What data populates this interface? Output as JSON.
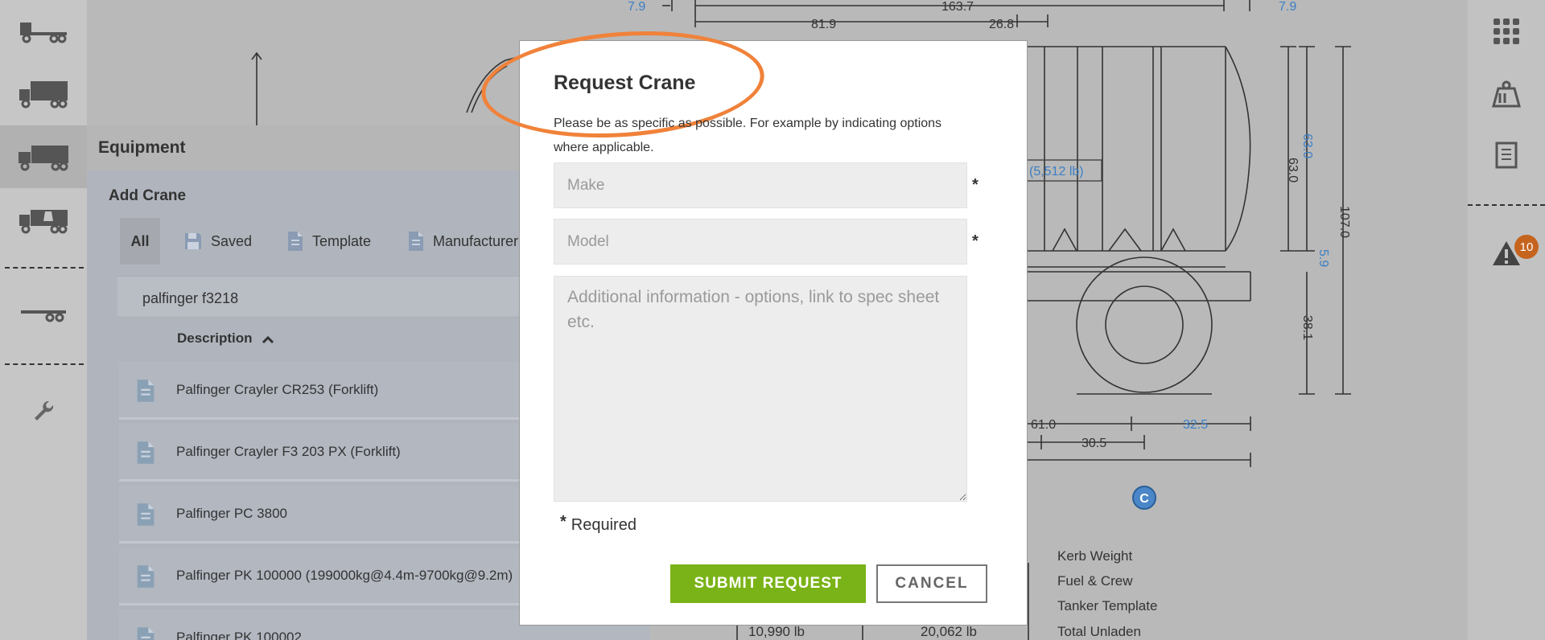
{
  "modal": {
    "title": "Request Crane",
    "description": "Please be as specific as possible. For example by indicating options where applicable.",
    "make_placeholder": "Make",
    "model_placeholder": "Model",
    "info_placeholder": "Additional information - options, link to spec sheet etc.",
    "required_marker": "*",
    "required_label": "Required",
    "submit_label": "SUBMIT REQUEST",
    "cancel_label": "CANCEL",
    "highlight_color": "#f0823a",
    "submit_color": "#7ab317"
  },
  "equipment_panel": {
    "title": "Equipment",
    "section_title": "Add Crane",
    "tabs": [
      {
        "label": "All",
        "icon": "list-icon"
      },
      {
        "label": "Saved",
        "icon": "floppy-disk-icon"
      },
      {
        "label": "Template",
        "icon": "document-icon"
      },
      {
        "label": "Manufacturer",
        "icon": "document-icon"
      }
    ],
    "search_value": "palfinger f3218",
    "column_header": "Description",
    "rows": [
      "Palfinger Crayler CR253 (Forklift)",
      "Palfinger Crayler F3 203 PX (Forklift)",
      "Palfinger PC 3800",
      "Palfinger PK 100000 (199000kg@4.4m-9700kg@9.2m)",
      "Palfinger PK 100002"
    ]
  },
  "left_rail": {
    "items": [
      "truck-chassis-icon",
      "box-truck-icon",
      "rigid-truck-icon",
      "truck-weight-icon",
      "trailer-icon",
      "wrench-icon"
    ]
  },
  "right_rail": {
    "items": [
      "apps-grid-icon",
      "weight-icon",
      "report-icon",
      "warning-icon"
    ],
    "alert_count": "10"
  },
  "drawing": {
    "dimensions": {
      "d1": "7.9",
      "d2": "163.7",
      "d3": "7.9",
      "d4": "81.9",
      "d5": "26.8",
      "d6": "63.0",
      "d7": "63.0",
      "d8": "107.0",
      "d9": "5.9",
      "d10": "38.1",
      "d11": "61.0",
      "d12": "32.5",
      "d13": "30.5"
    },
    "load_label": "(5,512 lb)",
    "center_marker": "C",
    "legend": [
      "Kerb Weight",
      "Fuel & Crew",
      "Tanker Template",
      "Total Unladen"
    ],
    "weights": [
      "10,990 lb",
      "20,062 lb"
    ]
  }
}
